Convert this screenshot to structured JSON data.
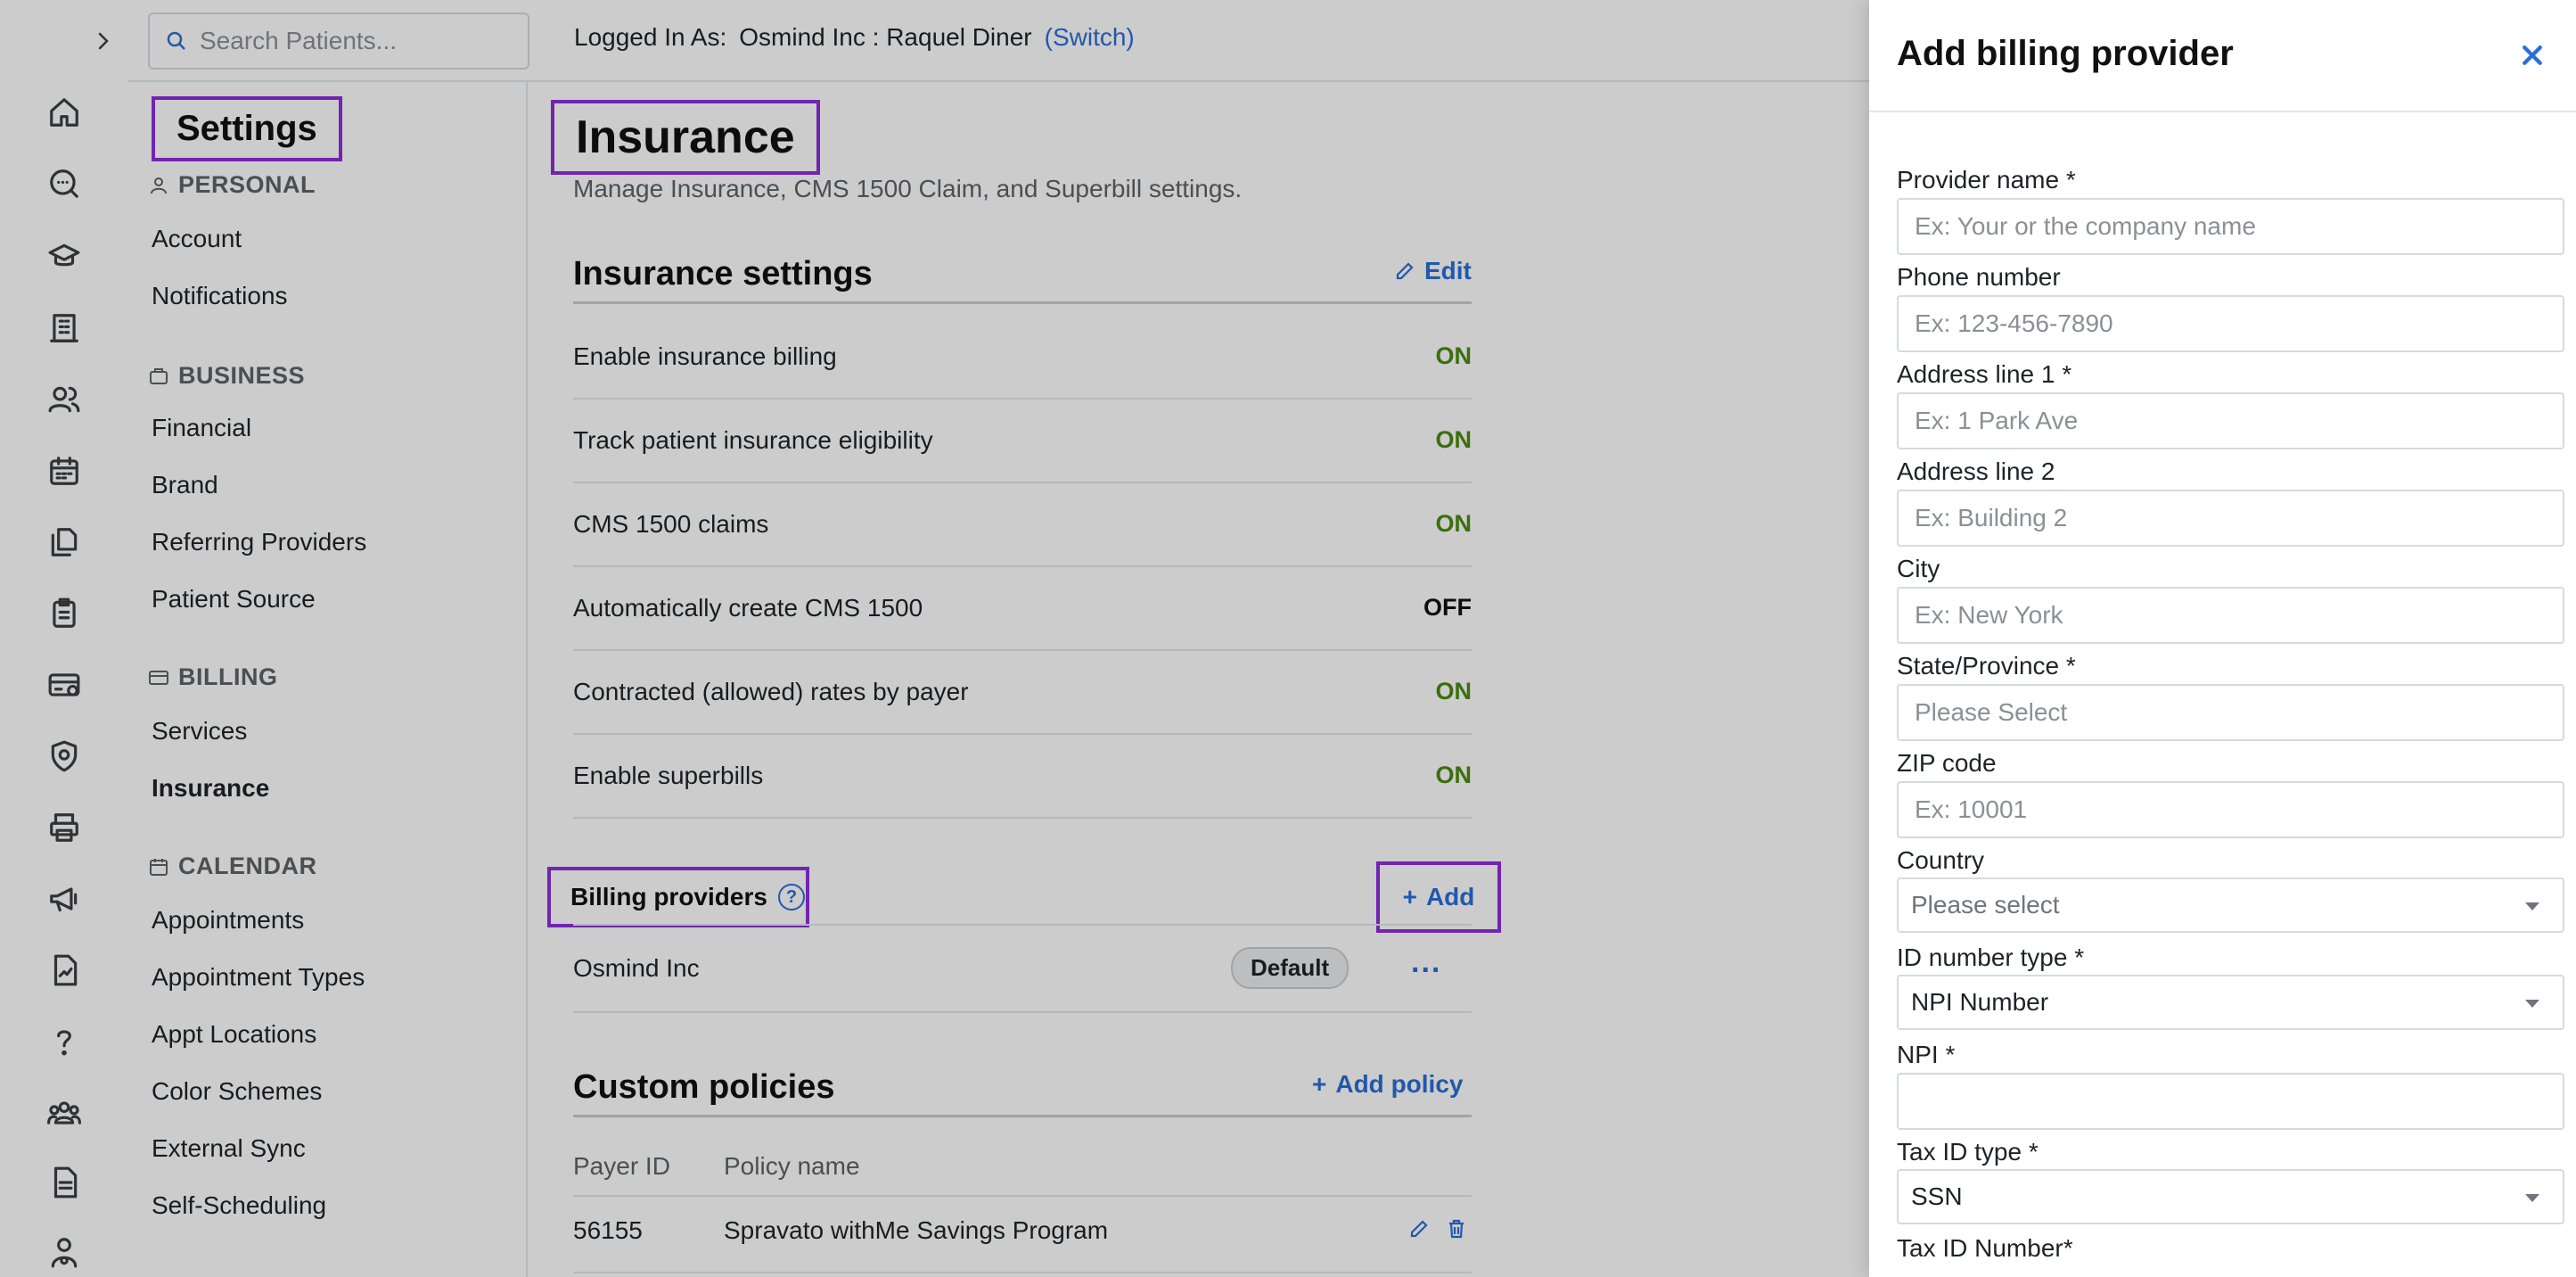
{
  "topbar": {
    "search_placeholder": "Search Patients...",
    "logged_in_label": "Logged In As:",
    "logged_in_org": "Osmind Inc : Raquel Diner",
    "switch_label": "(Switch)"
  },
  "settings_nav": {
    "title": "Settings",
    "sections": [
      {
        "heading": "PERSONAL",
        "icon": "person-icon",
        "items": [
          "Account",
          "Notifications"
        ]
      },
      {
        "heading": "BUSINESS",
        "icon": "briefcase-icon",
        "items": [
          "Financial",
          "Brand",
          "Referring Providers",
          "Patient Source"
        ]
      },
      {
        "heading": "BILLING",
        "icon": "billing-icon",
        "items": [
          "Services",
          "Insurance"
        ]
      },
      {
        "heading": "CALENDAR",
        "icon": "calendar-icon",
        "items": [
          "Appointments",
          "Appointment Types",
          "Appt Locations",
          "Color Schemes",
          "External Sync",
          "Self-Scheduling"
        ]
      }
    ],
    "active_item": "Insurance"
  },
  "main": {
    "title": "Insurance",
    "subtitle": "Manage Insurance, CMS 1500 Claim, and Superbill settings.",
    "insurance_settings": {
      "title": "Insurance settings",
      "edit_label": "Edit",
      "rows": [
        {
          "label": "Enable insurance billing",
          "value": "ON"
        },
        {
          "label": "Track patient insurance eligibility",
          "value": "ON"
        },
        {
          "label": "CMS 1500 claims",
          "value": "ON"
        },
        {
          "label": "Automatically create CMS 1500",
          "value": "OFF"
        },
        {
          "label": "Contracted (allowed) rates by payer",
          "value": "ON"
        },
        {
          "label": "Enable superbills",
          "value": "ON"
        }
      ]
    },
    "billing_providers": {
      "title": "Billing providers",
      "add_label": "Add",
      "providers": [
        {
          "name": "Osmind Inc",
          "badge": "Default",
          "more": "..."
        }
      ]
    },
    "custom_policies": {
      "title": "Custom policies",
      "add_label": "Add policy",
      "columns": [
        "Payer ID",
        "Policy name"
      ],
      "rows": [
        {
          "payer_id": "56155",
          "policy_name": "Spravato withMe Savings Program"
        }
      ]
    }
  },
  "drawer": {
    "title": "Add billing provider",
    "fields": {
      "provider_name": {
        "label": "Provider name *",
        "placeholder": "Ex: Your or the company name"
      },
      "phone": {
        "label": "Phone number",
        "placeholder": "Ex: 123-456-7890"
      },
      "address1": {
        "label": "Address line 1 *",
        "placeholder": "Ex: 1 Park Ave"
      },
      "address2": {
        "label": "Address line 2",
        "placeholder": "Ex: Building 2"
      },
      "city": {
        "label": "City",
        "placeholder": "Ex: New York"
      },
      "state": {
        "label": "State/Province *",
        "placeholder": "Please Select"
      },
      "zip": {
        "label": "ZIP code",
        "placeholder": "Ex: 10001"
      },
      "country": {
        "label": "Country",
        "value": "Please select"
      },
      "id_type": {
        "label": "ID number type *",
        "value": "NPI Number"
      },
      "npi": {
        "label": "NPI *",
        "placeholder": ""
      },
      "tax_id_type": {
        "label": "Tax ID type *",
        "value": "SSN"
      },
      "tax_id_number": {
        "label": "Tax ID Number*"
      }
    }
  },
  "colors": {
    "accent": "#2b6fd6",
    "highlight": "#8e2ddc",
    "on": "#4a8a12"
  },
  "rail_icons": [
    "home-icon",
    "messages-icon",
    "education-icon",
    "building-icon",
    "patients-icon",
    "calendar-icon",
    "documents-icon",
    "clipboard-icon",
    "billing-icon",
    "shield-icon",
    "printer-icon",
    "megaphone-icon",
    "report-icon",
    "help-icon",
    "groups-icon",
    "file-icon",
    "user-settings-icon"
  ]
}
